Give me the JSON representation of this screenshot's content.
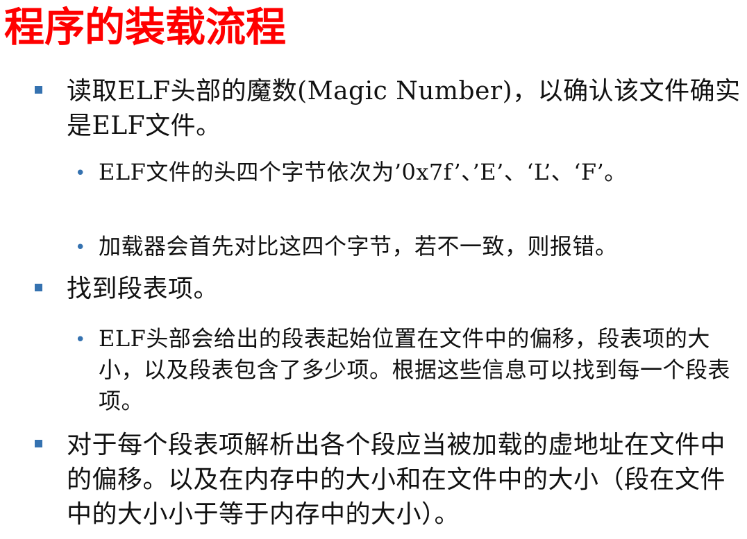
{
  "title": "程序的装载流程",
  "colors": {
    "title": "#ff0000",
    "bullet_marker": "#3572b0",
    "text": "#111111"
  },
  "bullets": [
    {
      "marker_icon": "square-bullet-icon",
      "text": "读取ELF头部的魔数(Magic Number)，以确认该文件确实是ELF文件。",
      "children": [
        {
          "marker": "•",
          "text": "ELF文件的头四个字节依次为’0x7f’、’E’、‘L’、‘F’。"
        },
        {
          "marker": "•",
          "text": "加载器会首先对比这四个字节，若不一致，则报错。"
        }
      ]
    },
    {
      "marker_icon": "square-bullet-icon",
      "text": "找到段表项。",
      "children": [
        {
          "marker": "•",
          "text": "ELF头部会给出的段表起始位置在文件中的偏移，段表项的大小，以及段表包含了多少项。根据这些信息可以找到每一个段表项。"
        }
      ]
    },
    {
      "marker_icon": "square-bullet-icon",
      "text": "对于每个段表项解析出各个段应当被加载的虚地址在文件中的偏移。以及在内存中的大小和在文件中的大小（段在文件中的大小小于等于内存中的大小）。",
      "children": []
    }
  ]
}
